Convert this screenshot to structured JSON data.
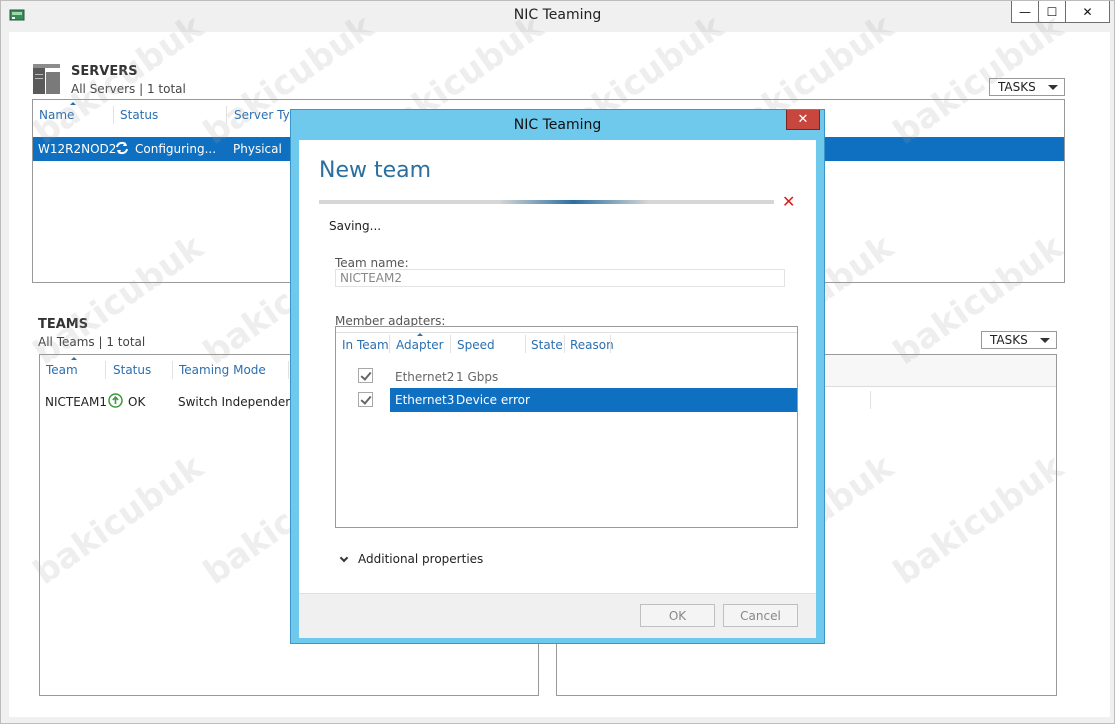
{
  "window": {
    "title": "NIC Teaming",
    "controls": {
      "minimize": "—",
      "maximize": "☐",
      "close": "✕"
    }
  },
  "servers": {
    "title": "SERVERS",
    "subtitle": "All Servers | 1 total",
    "tasks_label": "TASKS",
    "columns": [
      "Name",
      "Status",
      "Server Type"
    ],
    "rows": [
      {
        "name": "W12R2NOD2",
        "status": "Configuring...",
        "type": "Physical",
        "selected": true
      }
    ]
  },
  "teams": {
    "title": "TEAMS",
    "subtitle": "All Teams | 1 total",
    "tasks_label": "TASKS",
    "columns": [
      "Team",
      "Status",
      "Teaming Mode"
    ],
    "rows": [
      {
        "team": "NICTEAM1",
        "status": "OK",
        "mode": "Switch Independent"
      }
    ]
  },
  "dialog": {
    "title": "NIC Teaming",
    "close": "✕",
    "heading": "New team",
    "status_text": "Saving...",
    "team_name_label": "Team name:",
    "team_name_value": "NICTEAM2",
    "member_adapters_label": "Member adapters:",
    "columns": [
      "In Team",
      "Adapter",
      "Speed",
      "State",
      "Reason"
    ],
    "adapters": [
      {
        "adapter": "Ethernet2",
        "speed": "1 Gbps",
        "in_team": true,
        "selected": false
      },
      {
        "adapter": "Ethernet3",
        "speed": "Device error",
        "in_team": true,
        "selected": true
      }
    ],
    "additional_properties": "Additional properties",
    "ok_label": "OK",
    "cancel_label": "Cancel"
  },
  "watermark_text": "bakicubuk",
  "colors": {
    "selection": "#0f6fc1",
    "dialog_frame": "#6ec9ed",
    "accent_text": "#2a6fa0",
    "error": "#d81e1e",
    "ok_status": "#3a9a3a"
  }
}
